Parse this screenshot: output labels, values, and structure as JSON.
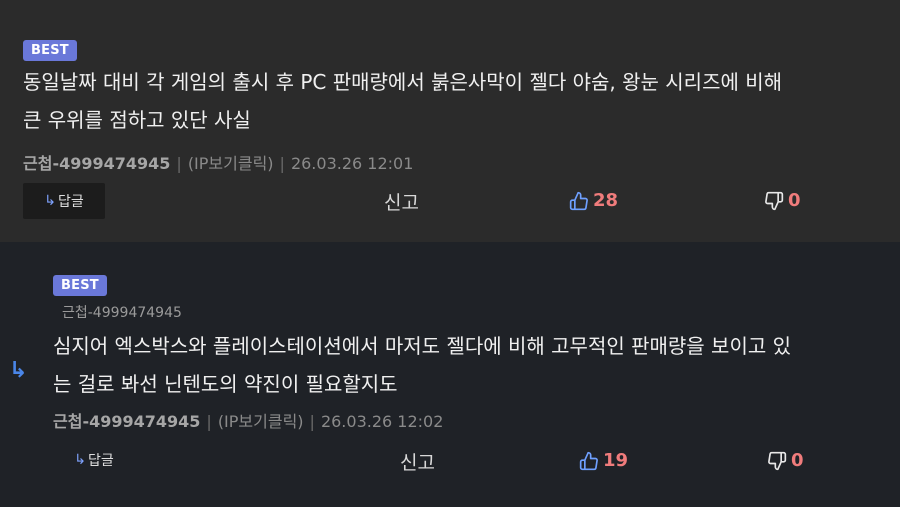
{
  "comments": [
    {
      "badge": "BEST",
      "text": "동일날짜 대비 각 게임의 출시 후 PC 판매량에서 붉은사막이 젤다 야숨, 왕눈 시리즈에 비해\n큰 우위를 점하고 있단 사실",
      "author": "근첩-4999474945",
      "ip_label": "(IP보기클릭)",
      "timestamp": "26.03.26 12:01",
      "reply_label": "답글",
      "report_label": "신고",
      "likes": "28",
      "dislikes": "0"
    },
    {
      "badge": "BEST",
      "reply_to": "근첩-4999474945",
      "text": "심지어 엑스박스와 플레이스테이션에서 마저도 젤다에 비해 고무적인 판매량을 보이고 있\n는 걸로 봐선 닌텐도의 약진이 필요할지도",
      "author": "근첩-4999474945",
      "ip_label": "(IP보기클릭)",
      "timestamp": "26.03.26 12:02",
      "reply_label": "답글",
      "report_label": "신고",
      "likes": "19",
      "dislikes": "0"
    }
  ],
  "icons": {
    "reply_arrow": "reply-arrow-icon",
    "thumbs_up": "thumbs-up-icon",
    "thumbs_down": "thumbs-down-icon",
    "reply_indicator": "reply-indicator-icon"
  },
  "colors": {
    "badge": "#6a78d9",
    "count": "#f07c7c",
    "reply_indicator": "#4a86e8"
  }
}
